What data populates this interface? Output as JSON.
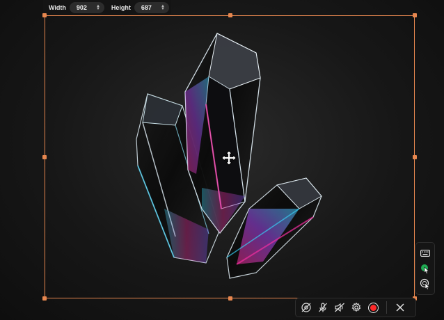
{
  "dimensions": {
    "width_label": "Width",
    "width_value": "902",
    "height_label": "Height",
    "height_value": "687"
  },
  "colors": {
    "frame": "#e7874f",
    "record": "#ff2a2a",
    "cursor_highlight": "#22c55e"
  },
  "icons": {
    "move": "move-arrows-icon",
    "keyboard": "keyboard-icon",
    "cursor_highlight": "cursor-highlight-icon",
    "click_effect": "click-effect-icon",
    "camera_off": "camera-off-icon",
    "mic_off": "mic-off-icon",
    "speaker_off": "speaker-off-icon",
    "settings": "gear-icon",
    "record": "record-icon",
    "close": "close-icon"
  }
}
